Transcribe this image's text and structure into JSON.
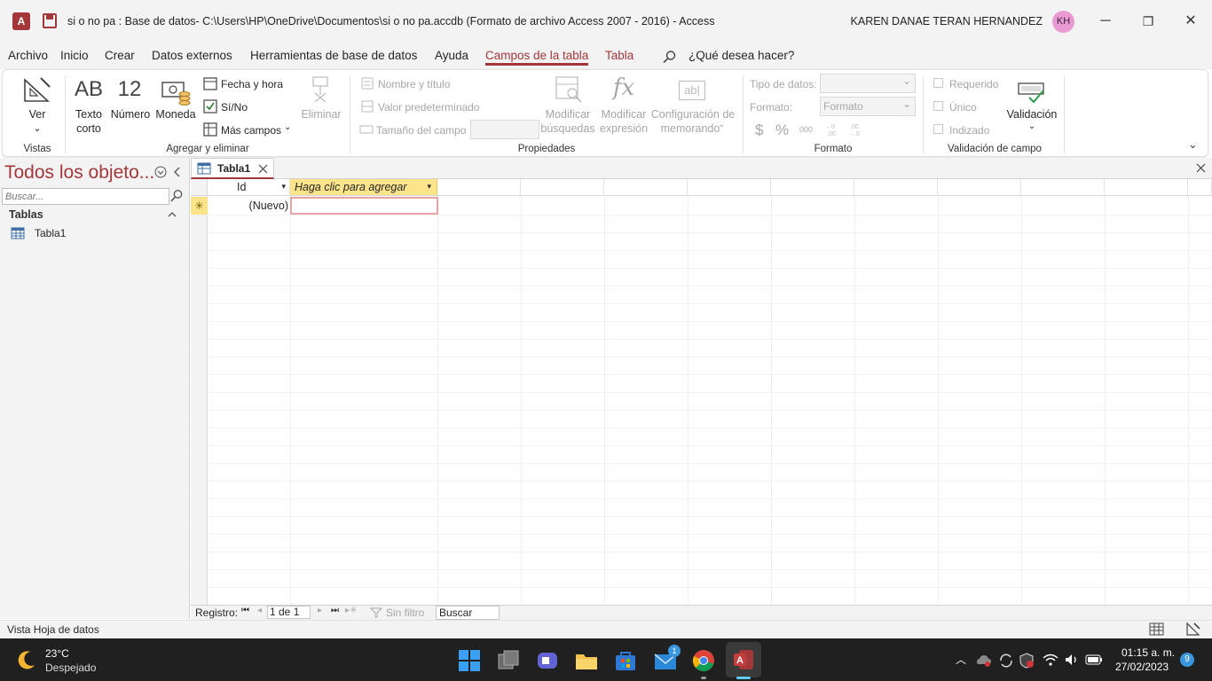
{
  "window": {
    "title": "si o no pa : Base de datos- C:\\Users\\HP\\OneDrive\\Documentos\\si o no pa.accdb (Formato de archivo Access 2007 - 2016)  -  Access",
    "user_name": "KAREN DANAE TERAN HERNANDEZ",
    "user_initials": "KH",
    "app_letter": "A",
    "minimize": "─",
    "restore": "❐",
    "close": "✕"
  },
  "menu": {
    "archivo": "Archivo",
    "inicio": "Inicio",
    "crear": "Crear",
    "datos_externos": "Datos externos",
    "herramientas": "Herramientas de base de datos",
    "ayuda": "Ayuda",
    "campos": "Campos de la tabla",
    "tabla": "Tabla",
    "search": "¿Qué desea hacer?"
  },
  "ribbon": {
    "vistas": {
      "ver": "Ver",
      "label": "Vistas"
    },
    "agregar": {
      "texto_icon": "AB",
      "texto": "Texto",
      "texto2": "corto",
      "numero_icon": "12",
      "numero": "Número",
      "moneda": "Moneda",
      "fecha": "Fecha y hora",
      "sino": "Sí/No",
      "mas": "Más campos",
      "eliminar": "Eliminar",
      "label": "Agregar y eliminar"
    },
    "propiedades": {
      "nombre": "Nombre y título",
      "valor": "Valor predeterminado",
      "tamano": "Tamaño del campo",
      "mod_busq1": "Modificar",
      "mod_busq2": "búsquedas",
      "mod_expr1": "Modificar",
      "mod_expr2": "expresión",
      "fx": "fx",
      "abl": "ab|",
      "config1": "Configuración de",
      "config2": "memorando",
      "label": "Propiedades"
    },
    "formato": {
      "tipo": "Tipo de datos:",
      "formato": "Formato:",
      "formato_value": "Formato",
      "dollar": "$",
      "percent": "%",
      "thousands": "000",
      "label": "Formato"
    },
    "validacion": {
      "requerido": "Requerido",
      "unico": "Único",
      "indizado": "Indizado",
      "validacion": "Validación",
      "label": "Validación de campo"
    }
  },
  "navpane": {
    "title": "Todos los objeto...",
    "search_placeholder": "Buscar...",
    "section": "Tablas",
    "items": [
      {
        "label": "Tabla1"
      }
    ]
  },
  "document": {
    "tab_label": "Tabla1",
    "columns": [
      "Id",
      "Haga clic para agregar"
    ],
    "new_row_marker": "✳",
    "new_row_value": "(Nuevo)"
  },
  "recordnav": {
    "label": "Registro:",
    "position": "1 de 1",
    "filter": "Sin filtro",
    "search": "Buscar"
  },
  "statusbar": {
    "text": "Vista Hoja de datos"
  },
  "taskbar": {
    "temp": "23°C",
    "weather": "Despejado",
    "time": "01:15 a. m.",
    "date": "27/02/2023",
    "mail_badge": "1",
    "notif_count": "9"
  },
  "colors": {
    "accent": "#a4373a",
    "field_highlight": "#fce48b",
    "avatar": "#ea9ad3"
  }
}
